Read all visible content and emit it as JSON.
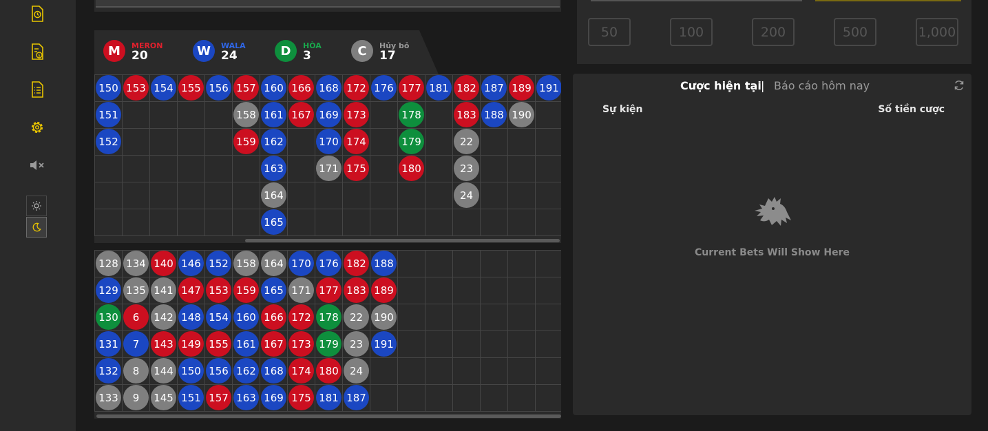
{
  "sidebar": {
    "icons": [
      "history-icon",
      "money-report-icon",
      "bet-list-icon",
      "settings-icon",
      "sound-mute-icon"
    ],
    "theme": {
      "light_icon": "sun-icon",
      "dark_icon": "moon-icon",
      "active": "dark"
    }
  },
  "summary": [
    {
      "letter": "M",
      "label": "MERON",
      "count": "20",
      "color": "#cc0f20"
    },
    {
      "letter": "W",
      "label": "WALA",
      "count": "24",
      "color": "#1b47c2"
    },
    {
      "letter": "D",
      "label": "HÒA",
      "count": "3",
      "color": "#0e8f3d"
    },
    {
      "letter": "C",
      "label": "Hủy bỏ",
      "count": "17",
      "color": "#7f7f7f"
    }
  ],
  "colors": {
    "b": "#1b47c2",
    "r": "#cc0f20",
    "g": "#7f7f7f",
    "gr": "#0e8f3d"
  },
  "road_top": {
    "columns": [
      [
        [
          "150",
          "b"
        ],
        [
          "151",
          "b"
        ],
        [
          "152",
          "b"
        ]
      ],
      [
        [
          "153",
          "r"
        ]
      ],
      [
        [
          "154",
          "b"
        ]
      ],
      [
        [
          "155",
          "r"
        ]
      ],
      [
        [
          "156",
          "b"
        ]
      ],
      [
        [
          "157",
          "r"
        ],
        [
          "158",
          "g"
        ],
        [
          "159",
          "r"
        ]
      ],
      [
        [
          "160",
          "b"
        ],
        [
          "161",
          "b"
        ],
        [
          "162",
          "b"
        ],
        [
          "163",
          "b"
        ],
        [
          "164",
          "g"
        ],
        [
          "165",
          "b"
        ]
      ],
      [
        [
          "166",
          "r"
        ],
        [
          "167",
          "r"
        ]
      ],
      [
        [
          "168",
          "b"
        ],
        [
          "169",
          "b"
        ],
        [
          "170",
          "b"
        ],
        [
          "171",
          "g"
        ]
      ],
      [
        [
          "172",
          "r"
        ],
        [
          "173",
          "r"
        ],
        [
          "174",
          "r"
        ],
        [
          "175",
          "r"
        ]
      ],
      [
        [
          "176",
          "b"
        ]
      ],
      [
        [
          "177",
          "r"
        ],
        [
          "178",
          "gr"
        ],
        [
          "179",
          "gr"
        ],
        [
          "180",
          "r"
        ]
      ],
      [
        [
          "181",
          "b"
        ]
      ],
      [
        [
          "182",
          "r"
        ],
        [
          "183",
          "r"
        ],
        [
          "22",
          "g"
        ],
        [
          "23",
          "g"
        ],
        [
          "24",
          "g"
        ]
      ],
      [
        [
          "187",
          "b"
        ],
        [
          "188",
          "b"
        ]
      ],
      [
        [
          "189",
          "r"
        ],
        [
          "190",
          "g"
        ]
      ],
      [
        [
          "191",
          "b"
        ]
      ]
    ]
  },
  "road_bottom": {
    "columns": [
      [
        [
          "128",
          "g"
        ],
        [
          "129",
          "b"
        ],
        [
          "130",
          "gr"
        ],
        [
          "131",
          "b"
        ],
        [
          "132",
          "b"
        ],
        [
          "133",
          "g"
        ]
      ],
      [
        [
          "134",
          "g"
        ],
        [
          "135",
          "g"
        ],
        [
          "6",
          "r"
        ],
        [
          "7",
          "b"
        ],
        [
          "8",
          "g"
        ],
        [
          "9",
          "g"
        ]
      ],
      [
        [
          "140",
          "r"
        ],
        [
          "141",
          "g"
        ],
        [
          "142",
          "g"
        ],
        [
          "143",
          "r"
        ],
        [
          "144",
          "g"
        ],
        [
          "145",
          "g"
        ]
      ],
      [
        [
          "146",
          "b"
        ],
        [
          "147",
          "r"
        ],
        [
          "148",
          "b"
        ],
        [
          "149",
          "r"
        ],
        [
          "150",
          "b"
        ],
        [
          "151",
          "b"
        ]
      ],
      [
        [
          "152",
          "b"
        ],
        [
          "153",
          "r"
        ],
        [
          "154",
          "b"
        ],
        [
          "155",
          "r"
        ],
        [
          "156",
          "b"
        ],
        [
          "157",
          "r"
        ]
      ],
      [
        [
          "158",
          "g"
        ],
        [
          "159",
          "r"
        ],
        [
          "160",
          "b"
        ],
        [
          "161",
          "b"
        ],
        [
          "162",
          "b"
        ],
        [
          "163",
          "b"
        ]
      ],
      [
        [
          "164",
          "g"
        ],
        [
          "165",
          "b"
        ],
        [
          "166",
          "r"
        ],
        [
          "167",
          "r"
        ],
        [
          "168",
          "b"
        ],
        [
          "169",
          "b"
        ]
      ],
      [
        [
          "170",
          "b"
        ],
        [
          "171",
          "g"
        ],
        [
          "172",
          "r"
        ],
        [
          "173",
          "r"
        ],
        [
          "174",
          "r"
        ],
        [
          "175",
          "r"
        ]
      ],
      [
        [
          "176",
          "b"
        ],
        [
          "177",
          "r"
        ],
        [
          "178",
          "gr"
        ],
        [
          "179",
          "gr"
        ],
        [
          "180",
          "r"
        ],
        [
          "181",
          "b"
        ]
      ],
      [
        [
          "182",
          "r"
        ],
        [
          "183",
          "r"
        ],
        [
          "22",
          "g"
        ],
        [
          "23",
          "g"
        ],
        [
          "24",
          "g"
        ],
        [
          "187",
          "b"
        ]
      ],
      [
        [
          "188",
          "b"
        ],
        [
          "189",
          "r"
        ],
        [
          "190",
          "g"
        ],
        [
          "191",
          "b"
        ]
      ]
    ]
  },
  "chips": [
    "50",
    "100",
    "200",
    "500",
    "1,000"
  ],
  "bets_panel": {
    "tab_current": "Cược hiện tại",
    "tab_separator": "|",
    "tab_report": "Báo cáo hôm nay",
    "col_event": "Sự kiện",
    "col_amount": "Số tiền cược",
    "empty_text": "Current Bets Will Show Here",
    "empty_icon": "rooster-icon",
    "refresh_icon": "refresh-icon"
  }
}
